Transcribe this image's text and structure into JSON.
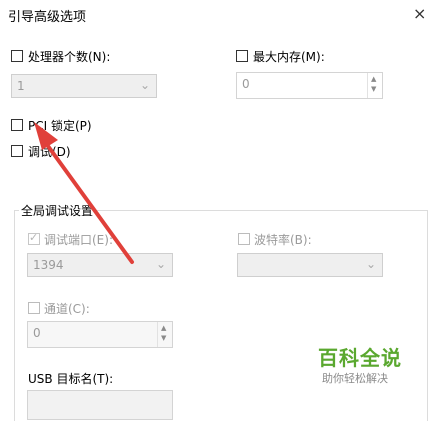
{
  "window": {
    "title": "引导高级选项",
    "close_glyph": "×"
  },
  "processor": {
    "label": "处理器个数(N):",
    "value": "1"
  },
  "max_memory": {
    "label": "最大内存(M):",
    "value": "0"
  },
  "pci_lock": {
    "label": "PCI 锁定(P)"
  },
  "debug": {
    "label": "调试(D)"
  },
  "global_debug": {
    "group_title": "全局调试设置",
    "debug_port": {
      "label": "调试端口(E):",
      "value": "1394",
      "checked": true
    },
    "baud_rate": {
      "label": "波特率(B):",
      "value": ""
    },
    "channel": {
      "label": "通道(C):",
      "value": "0"
    },
    "usb_target": {
      "label": "USB 目标名(T):"
    }
  },
  "watermark": {
    "main": "百科全说",
    "sub": "助你轻松解决"
  },
  "icons": {
    "close": "close-icon",
    "dropdown": "chevron-down-icon",
    "spin_up": "spin-up-icon",
    "spin_down": "spin-down-icon",
    "arrow": "red-arrow-annotation"
  },
  "colors": {
    "annotation_arrow": "#e0403a",
    "watermark_green": "#5aa82f"
  }
}
